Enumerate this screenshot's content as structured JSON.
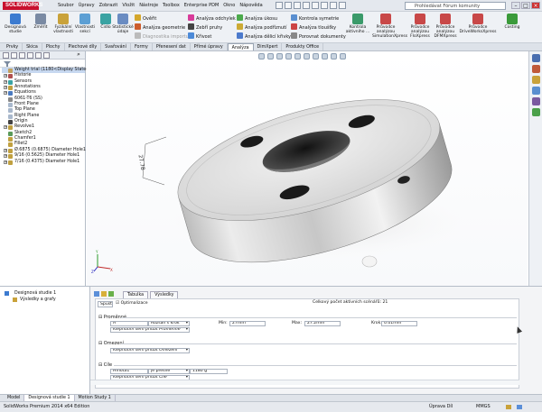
{
  "titlebar": {
    "brand": "SOLIDWORKS",
    "menu": [
      "Soubor",
      "Úpravy",
      "Zobrazit",
      "Vložit",
      "Nástroje",
      "Toolbox",
      "Enterprise PDM",
      "Okno",
      "Nápověda"
    ],
    "search_placeholder": "Prohledávat Fórum komunity"
  },
  "ribbon": {
    "big_buttons": [
      {
        "label": "Designová studie",
        "icon": "design-study-icon",
        "color": "#3c7bd0"
      },
      {
        "label": "Změřit",
        "icon": "measure-icon",
        "color": "#7a8aa3"
      },
      {
        "label": "Fyzikální vlastnosti",
        "icon": "mass-properties-icon",
        "color": "#c9a23a"
      },
      {
        "label": "Vlastnosti sekcí",
        "icon": "section-properties-icon",
        "color": "#5c9fd4"
      },
      {
        "label": "Čidlo",
        "icon": "sensor-icon",
        "color": "#3aa3a3"
      },
      {
        "label": "Statistické údaje",
        "icon": "statistics-icon",
        "color": "#6a8cc2"
      }
    ],
    "col1": [
      {
        "label": "Ověřit",
        "icon": "check-icon",
        "color": "#d4a72c"
      },
      {
        "label": "Analýza geometrie",
        "icon": "geometry-analysis-icon",
        "color": "#cc5c2c"
      },
      {
        "label": "Diagnostika importu",
        "icon": "import-diagnostics-icon",
        "color": "#bbbbbb",
        "disabled": true
      }
    ],
    "col2": [
      {
        "label": "Analýza odchylek",
        "icon": "deviation-analysis-icon",
        "color": "#d83c9a"
      },
      {
        "label": "Zebří pruhy",
        "icon": "zebra-stripes-icon",
        "color": "#444444"
      },
      {
        "label": "Křivost",
        "icon": "curvature-icon",
        "color": "#4c8ad8"
      }
    ],
    "col3": [
      {
        "label": "Analýza úkosu",
        "icon": "draft-analysis-icon",
        "color": "#4caa4c"
      },
      {
        "label": "Analýza podříznutí",
        "icon": "undercut-analysis-icon",
        "color": "#ccaa33"
      },
      {
        "label": "Analýza dělicí křivky",
        "icon": "parting-line-icon",
        "color": "#4c7acc"
      }
    ],
    "col4": [
      {
        "label": "Kontrola symetrie",
        "icon": "symmetry-check-icon",
        "color": "#5a8fd0"
      },
      {
        "label": "Analýza tloušťky",
        "icon": "thickness-analysis-icon",
        "color": "#cc4444"
      },
      {
        "label": "Porovnat dokumenty",
        "icon": "compare-documents-icon",
        "color": "#888888"
      }
    ],
    "right_buttons": [
      {
        "label": "Kontrola aktivního ...",
        "icon": "check-active-icon",
        "color": "#3a9a6a"
      },
      {
        "label": "Průvodce analýzou SimulationXpress",
        "icon": "simulationxpress-icon",
        "color": "#c84848"
      },
      {
        "label": "Průvodce analýzou FloXpress",
        "icon": "floxpress-icon",
        "color": "#c84848"
      },
      {
        "label": "Průvodce analýzou DFMXpress",
        "icon": "dfmxpress-icon",
        "color": "#c84848"
      },
      {
        "label": "Průvodce DriveWorksXpress",
        "icon": "driveworksxpress-icon",
        "color": "#c84848"
      },
      {
        "label": "Costing",
        "icon": "costing-icon",
        "color": "#3a9a3a"
      }
    ]
  },
  "tabs": [
    "Prvky",
    "Skica",
    "Plochy",
    "Plechové díly",
    "Svařování",
    "Formy",
    "Přenesení dat",
    "Přímé úpravy",
    "Analýza",
    "DimXpert",
    "Produkty Office"
  ],
  "active_tab": "Analýza",
  "feature_tree": [
    {
      "label": "Weight trial  (1180<Display State-",
      "icon": "part-icon",
      "color": "#c0a060",
      "exp": ""
    },
    {
      "label": "Historie",
      "icon": "history-icon",
      "color": "#b05050",
      "exp": "+"
    },
    {
      "label": "Sensors",
      "icon": "sensors-icon",
      "color": "#3aa3a3",
      "exp": "+"
    },
    {
      "label": "Annotations",
      "icon": "annotations-icon",
      "color": "#c0a040",
      "exp": "+"
    },
    {
      "label": "Equations",
      "icon": "equations-icon",
      "color": "#4a7ac0",
      "exp": "+"
    },
    {
      "label": "6061-T6 (SS)",
      "icon": "material-icon",
      "color": "#888888",
      "exp": ""
    },
    {
      "label": "Front Plane",
      "icon": "plane-icon",
      "color": "#a9b8cc",
      "exp": ""
    },
    {
      "label": "Top Plane",
      "icon": "plane-icon",
      "color": "#a9b8cc",
      "exp": ""
    },
    {
      "label": "Right Plane",
      "icon": "plane-icon",
      "color": "#a9b8cc",
      "exp": ""
    },
    {
      "label": "Origin",
      "icon": "origin-icon",
      "color": "#444444",
      "exp": ""
    },
    {
      "label": "Revolve1",
      "icon": "revolve-icon",
      "color": "#c0a040",
      "exp": "+"
    },
    {
      "label": "Sketch2",
      "icon": "sketch-icon",
      "color": "#5a9a5a",
      "exp": ""
    },
    {
      "label": "Chamfer1",
      "icon": "chamfer-icon",
      "color": "#c0a040",
      "exp": ""
    },
    {
      "label": "Fillet2",
      "icon": "fillet-icon",
      "color": "#c0a040",
      "exp": ""
    },
    {
      "label": "Ø.6875 (0.6875) Diameter Hole1",
      "icon": "hole-icon",
      "color": "#c0a040",
      "exp": "+"
    },
    {
      "label": "9/16 (0.5625) Diameter Hole1",
      "icon": "hole-icon",
      "color": "#c0a040",
      "exp": "+"
    },
    {
      "label": "7/16 (0.4375) Diameter Hole1",
      "icon": "hole-icon",
      "color": "#c0a040",
      "exp": "+"
    }
  ],
  "viewport": {
    "dimension": "27.78"
  },
  "study_tree": [
    "Designová studie 1",
    "Výsledky a grafy"
  ],
  "study": {
    "tabs": [
      "Tabulka",
      "Výsledky"
    ],
    "run_label": "Spustit",
    "optimize_label": "Optimalizace",
    "total_scenarios": "Celkový počet aktivních scénářů: 21",
    "section_vars": "Proměnné",
    "var": {
      "name": "A",
      "mode": "Rozsah s krok",
      "min_label": "Min:",
      "min": "27mm",
      "max_label": "Max:",
      "max": "27.2mm",
      "step_label": "Krok:",
      "step": "0.01mm",
      "add": "Klepnutím sem přidat Proměnné"
    },
    "section_constraints": "Omezení",
    "constraints_add": "Klepnutím sem přidat Omezení",
    "section_goals": "Cíle",
    "goal": {
      "name": "Hmota1",
      "mode": "je přesně",
      "value": "1180 g",
      "add": "Klepnutím sem přidat Cíle"
    }
  },
  "bottom_tabs": [
    "Model",
    "Designová studie 1",
    "Motion Study 1"
  ],
  "active_bottom_tab": "Designová studie 1",
  "status": {
    "left": "SolidWorks Premium 2014 x64 Edition",
    "editing": "Úprava Díl",
    "units": "MMGS"
  }
}
